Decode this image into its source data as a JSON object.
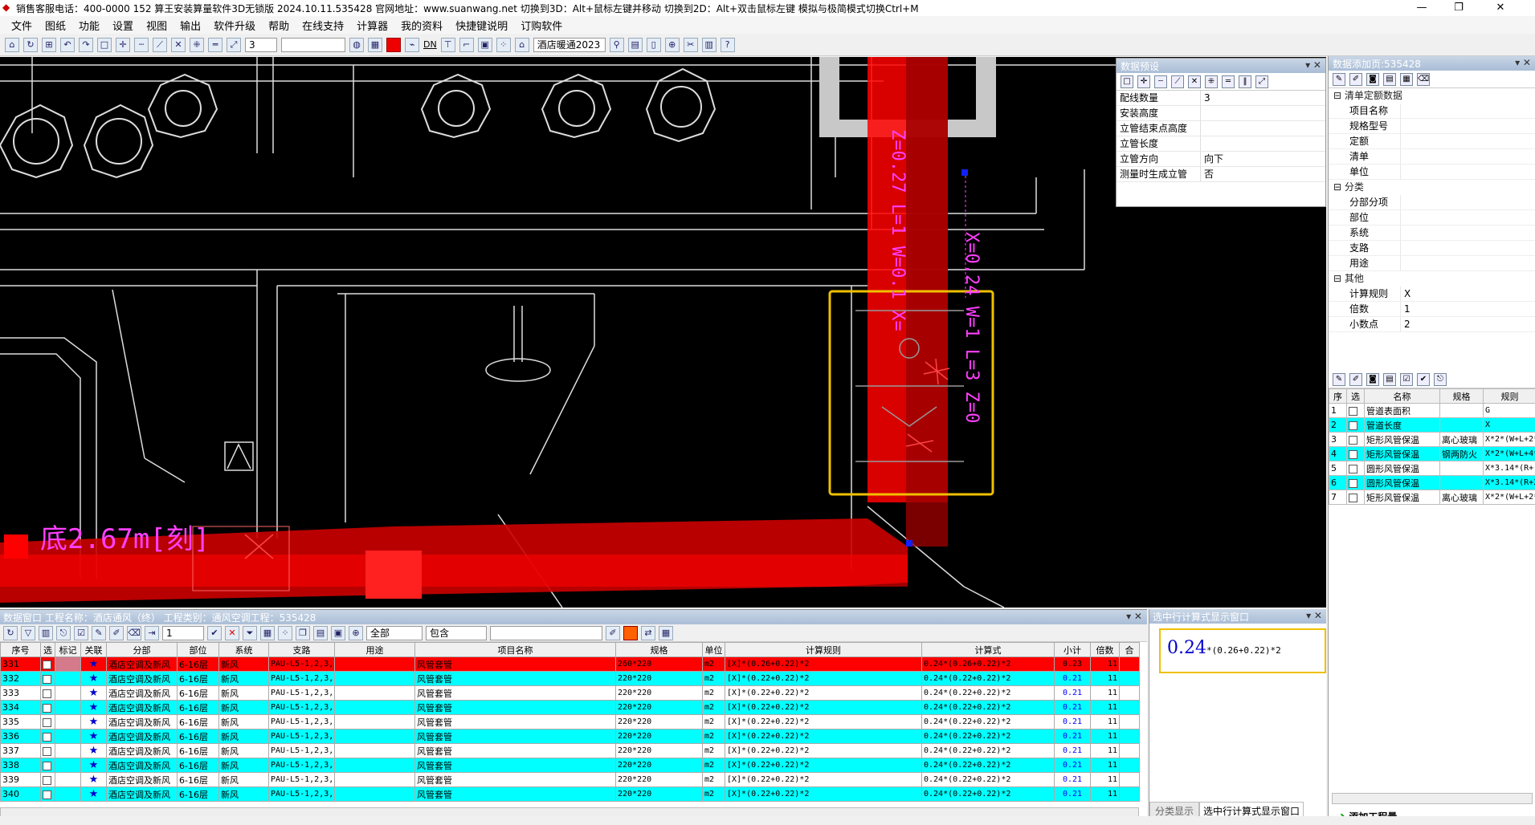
{
  "titlebar": {
    "text": "销售客服电话：400-0000 152   算王安装算量软件3D无锁版 2024.10.11.535428 官网地址：www.suanwang.net  切换到3D：Alt+鼠标左键并移动  切换到2D：Alt+双击鼠标左键 模拟与极简模式切换Ctrl+M",
    "minimize": "—",
    "maximize": "❐",
    "close": "✕"
  },
  "menu": [
    "文件",
    "图纸",
    "功能",
    "设置",
    "视图",
    "输出",
    "软件升级",
    "帮助",
    "在线支持",
    "计算器",
    "我的资料",
    "快捷键说明",
    "订购软件"
  ],
  "toolbar": {
    "layer_value": "3",
    "project_select": "酒店暖通2023",
    "dn_label": "DN"
  },
  "canvas": {
    "pipe_label_vertical": "Z=0.27 L=1 W=0.1 X=",
    "pipe_label_dim": "X=0.24 W=1 L=3 Z=0",
    "duct_label": "底2.67m[刻]"
  },
  "preset_panel": {
    "title": "数据预设",
    "rows": [
      {
        "k": "配线数量",
        "v": "3"
      },
      {
        "k": "安装高度",
        "v": ""
      },
      {
        "k": "立管结束点高度",
        "v": ""
      },
      {
        "k": "立管长度",
        "v": ""
      },
      {
        "k": "立管方向",
        "v": "向下"
      },
      {
        "k": "测量时生成立管",
        "v": "否"
      }
    ]
  },
  "right_panel": {
    "title": "数据添加页:535428",
    "groups": [
      {
        "name": "清单定额数据",
        "rows": [
          {
            "k": "项目名称",
            "v": ""
          },
          {
            "k": "规格型号",
            "v": ""
          },
          {
            "k": "定额",
            "v": ""
          },
          {
            "k": "清单",
            "v": ""
          },
          {
            "k": "单位",
            "v": ""
          }
        ]
      },
      {
        "name": "分类",
        "rows": [
          {
            "k": "分部分项",
            "v": ""
          },
          {
            "k": "部位",
            "v": ""
          },
          {
            "k": "系统",
            "v": ""
          },
          {
            "k": "支路",
            "v": ""
          },
          {
            "k": "用途",
            "v": ""
          }
        ]
      },
      {
        "name": "其他",
        "rows": [
          {
            "k": "计算规则",
            "v": "X"
          },
          {
            "k": "倍数",
            "v": "1"
          },
          {
            "k": "小数点",
            "v": "2"
          }
        ]
      }
    ],
    "rule_headers": [
      "序",
      "选",
      "名称",
      "规格",
      "规则"
    ],
    "rules": [
      {
        "n": "1",
        "name": "管道表面积",
        "spec": "",
        "rule": "G",
        "cyan": false
      },
      {
        "n": "2",
        "name": "管道长度",
        "spec": "",
        "rule": "X",
        "cyan": true
      },
      {
        "n": "3",
        "name": "矩形风管保温",
        "spec": "离心玻璃",
        "rule": "X*2*(W+L+2*",
        "cyan": false
      },
      {
        "n": "4",
        "name": "矩形风管保温",
        "spec": "钢两防火",
        "rule": "X*2*(W+L+4*",
        "cyan": true
      },
      {
        "n": "5",
        "name": "圆形风管保温",
        "spec": "",
        "rule": "X*3.14*(R+",
        "cyan": false
      },
      {
        "n": "6",
        "name": "圆形风管保温",
        "spec": "",
        "rule": "X*3.14*(R+2",
        "cyan": true
      },
      {
        "n": "7",
        "name": "矩形风管保温",
        "spec": "离心玻璃",
        "rule": "X*2*(W+L+2*",
        "cyan": false
      }
    ],
    "add_button": "添加工程量"
  },
  "data_window": {
    "title": "数据窗口  工程名称：酒店通风（终）  工程类别：通风空调工程：535428",
    "filter_all": "全部",
    "filter_contains": "包含",
    "headers": [
      "序号",
      "选",
      "标记",
      "关联",
      "分部",
      "部位",
      "系统",
      "支路",
      "用途",
      "项目名称",
      "规格",
      "单位",
      "计算规则",
      "计算式",
      "小计",
      "倍数",
      "合"
    ],
    "rows": [
      {
        "n": "331",
        "fb": "酒店空调及新风",
        "bw": "6-16层",
        "xt": "新风",
        "zl": "PAU-L5-1,2,3,",
        "yt": "",
        "xm": "风管套管",
        "gg": "260*220",
        "dw": "m2",
        "gz": "[X]*(0.26+0.22)*2",
        "js": "0.24*(0.26+0.22)*2",
        "xj": "0.23",
        "bs": "11",
        "cls": "sel"
      },
      {
        "n": "332",
        "fb": "酒店空调及新风",
        "bw": "6-16层",
        "xt": "新风",
        "zl": "PAU-L5-1,2,3,",
        "yt": "",
        "xm": "风管套管",
        "gg": "220*220",
        "dw": "m2",
        "gz": "[X]*(0.22+0.22)*2",
        "js": "0.24*(0.22+0.22)*2",
        "xj": "0.21",
        "bs": "11",
        "cls": "cy"
      },
      {
        "n": "333",
        "fb": "酒店空调及新风",
        "bw": "6-16层",
        "xt": "新风",
        "zl": "PAU-L5-1,2,3,",
        "yt": "",
        "xm": "风管套管",
        "gg": "220*220",
        "dw": "m2",
        "gz": "[X]*(0.22+0.22)*2",
        "js": "0.24*(0.22+0.22)*2",
        "xj": "0.21",
        "bs": "11",
        "cls": "wh"
      },
      {
        "n": "334",
        "fb": "酒店空调及新风",
        "bw": "6-16层",
        "xt": "新风",
        "zl": "PAU-L5-1,2,3,",
        "yt": "",
        "xm": "风管套管",
        "gg": "220*220",
        "dw": "m2",
        "gz": "[X]*(0.22+0.22)*2",
        "js": "0.24*(0.22+0.22)*2",
        "xj": "0.21",
        "bs": "11",
        "cls": "cy"
      },
      {
        "n": "335",
        "fb": "酒店空调及新风",
        "bw": "6-16层",
        "xt": "新风",
        "zl": "PAU-L5-1,2,3,",
        "yt": "",
        "xm": "风管套管",
        "gg": "220*220",
        "dw": "m2",
        "gz": "[X]*(0.22+0.22)*2",
        "js": "0.24*(0.22+0.22)*2",
        "xj": "0.21",
        "bs": "11",
        "cls": "wh"
      },
      {
        "n": "336",
        "fb": "酒店空调及新风",
        "bw": "6-16层",
        "xt": "新风",
        "zl": "PAU-L5-1,2,3,",
        "yt": "",
        "xm": "风管套管",
        "gg": "220*220",
        "dw": "m2",
        "gz": "[X]*(0.22+0.22)*2",
        "js": "0.24*(0.22+0.22)*2",
        "xj": "0.21",
        "bs": "11",
        "cls": "cy"
      },
      {
        "n": "337",
        "fb": "酒店空调及新风",
        "bw": "6-16层",
        "xt": "新风",
        "zl": "PAU-L5-1,2,3,",
        "yt": "",
        "xm": "风管套管",
        "gg": "220*220",
        "dw": "m2",
        "gz": "[X]*(0.22+0.22)*2",
        "js": "0.24*(0.22+0.22)*2",
        "xj": "0.21",
        "bs": "11",
        "cls": "wh"
      },
      {
        "n": "338",
        "fb": "酒店空调及新风",
        "bw": "6-16层",
        "xt": "新风",
        "zl": "PAU-L5-1,2,3,",
        "yt": "",
        "xm": "风管套管",
        "gg": "220*220",
        "dw": "m2",
        "gz": "[X]*(0.22+0.22)*2",
        "js": "0.24*(0.22+0.22)*2",
        "xj": "0.21",
        "bs": "11",
        "cls": "cy"
      },
      {
        "n": "339",
        "fb": "酒店空调及新风",
        "bw": "6-16层",
        "xt": "新风",
        "zl": "PAU-L5-1,2,3,",
        "yt": "",
        "xm": "风管套管",
        "gg": "220*220",
        "dw": "m2",
        "gz": "[X]*(0.22+0.22)*2",
        "js": "0.24*(0.22+0.22)*2",
        "xj": "0.21",
        "bs": "11",
        "cls": "wh"
      },
      {
        "n": "340",
        "fb": "酒店空调及新风",
        "bw": "6-16层",
        "xt": "新风",
        "zl": "PAU-L5-1,2,3,",
        "yt": "",
        "xm": "风管套管",
        "gg": "220*220",
        "dw": "m2",
        "gz": "[X]*(0.22+0.22)*2",
        "js": "0.24*(0.22+0.22)*2",
        "xj": "0.21",
        "bs": "11",
        "cls": "cy"
      }
    ]
  },
  "formula_window": {
    "title": "选中行计算式显示窗口",
    "big": "0.24",
    "rest": "*(0.26+0.22)*2",
    "tab1": "分类显示",
    "tab2": "选中行计算式显示窗口"
  }
}
